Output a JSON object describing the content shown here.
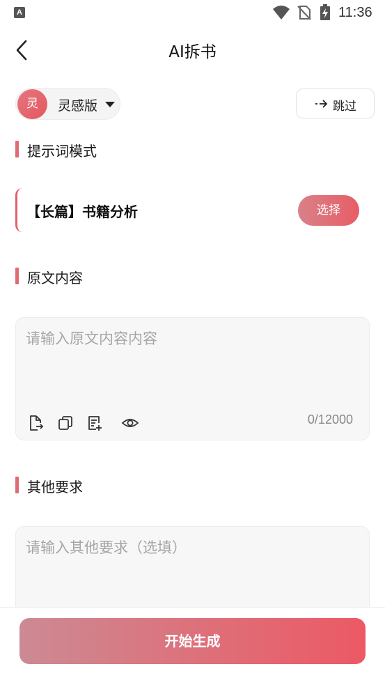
{
  "status_bar": {
    "app_badge": "A",
    "time": "11:36",
    "icons": [
      "wifi-icon",
      "no-sim-icon",
      "battery-charging-icon"
    ]
  },
  "header": {
    "title": "AI拆书",
    "back_icon": "chevron-left-icon"
  },
  "version": {
    "avatar_text": "灵",
    "label": "灵感版",
    "dropdown_icon": "caret-down-icon"
  },
  "skip": {
    "label": "跳过",
    "icon": "arrow-right-icon"
  },
  "prompt_section": {
    "heading": "提示词模式",
    "selected_prompt": "【长篇】书籍分析",
    "choose_label": "选择"
  },
  "source_section": {
    "heading": "原文内容",
    "value": "",
    "placeholder": "请输入原文内容内容",
    "char_count": "0/12000",
    "tools": [
      "import-file-icon",
      "copy-icon",
      "add-note-icon",
      "eye-icon"
    ]
  },
  "other_section": {
    "heading": "其他要求",
    "value": "",
    "placeholder": "请输入其他要求（选填）"
  },
  "actions": {
    "start_label": "开始生成"
  },
  "colors": {
    "accent": "#e85d66",
    "accent_light": "#d98189",
    "input_bg": "#f7f7f7"
  }
}
